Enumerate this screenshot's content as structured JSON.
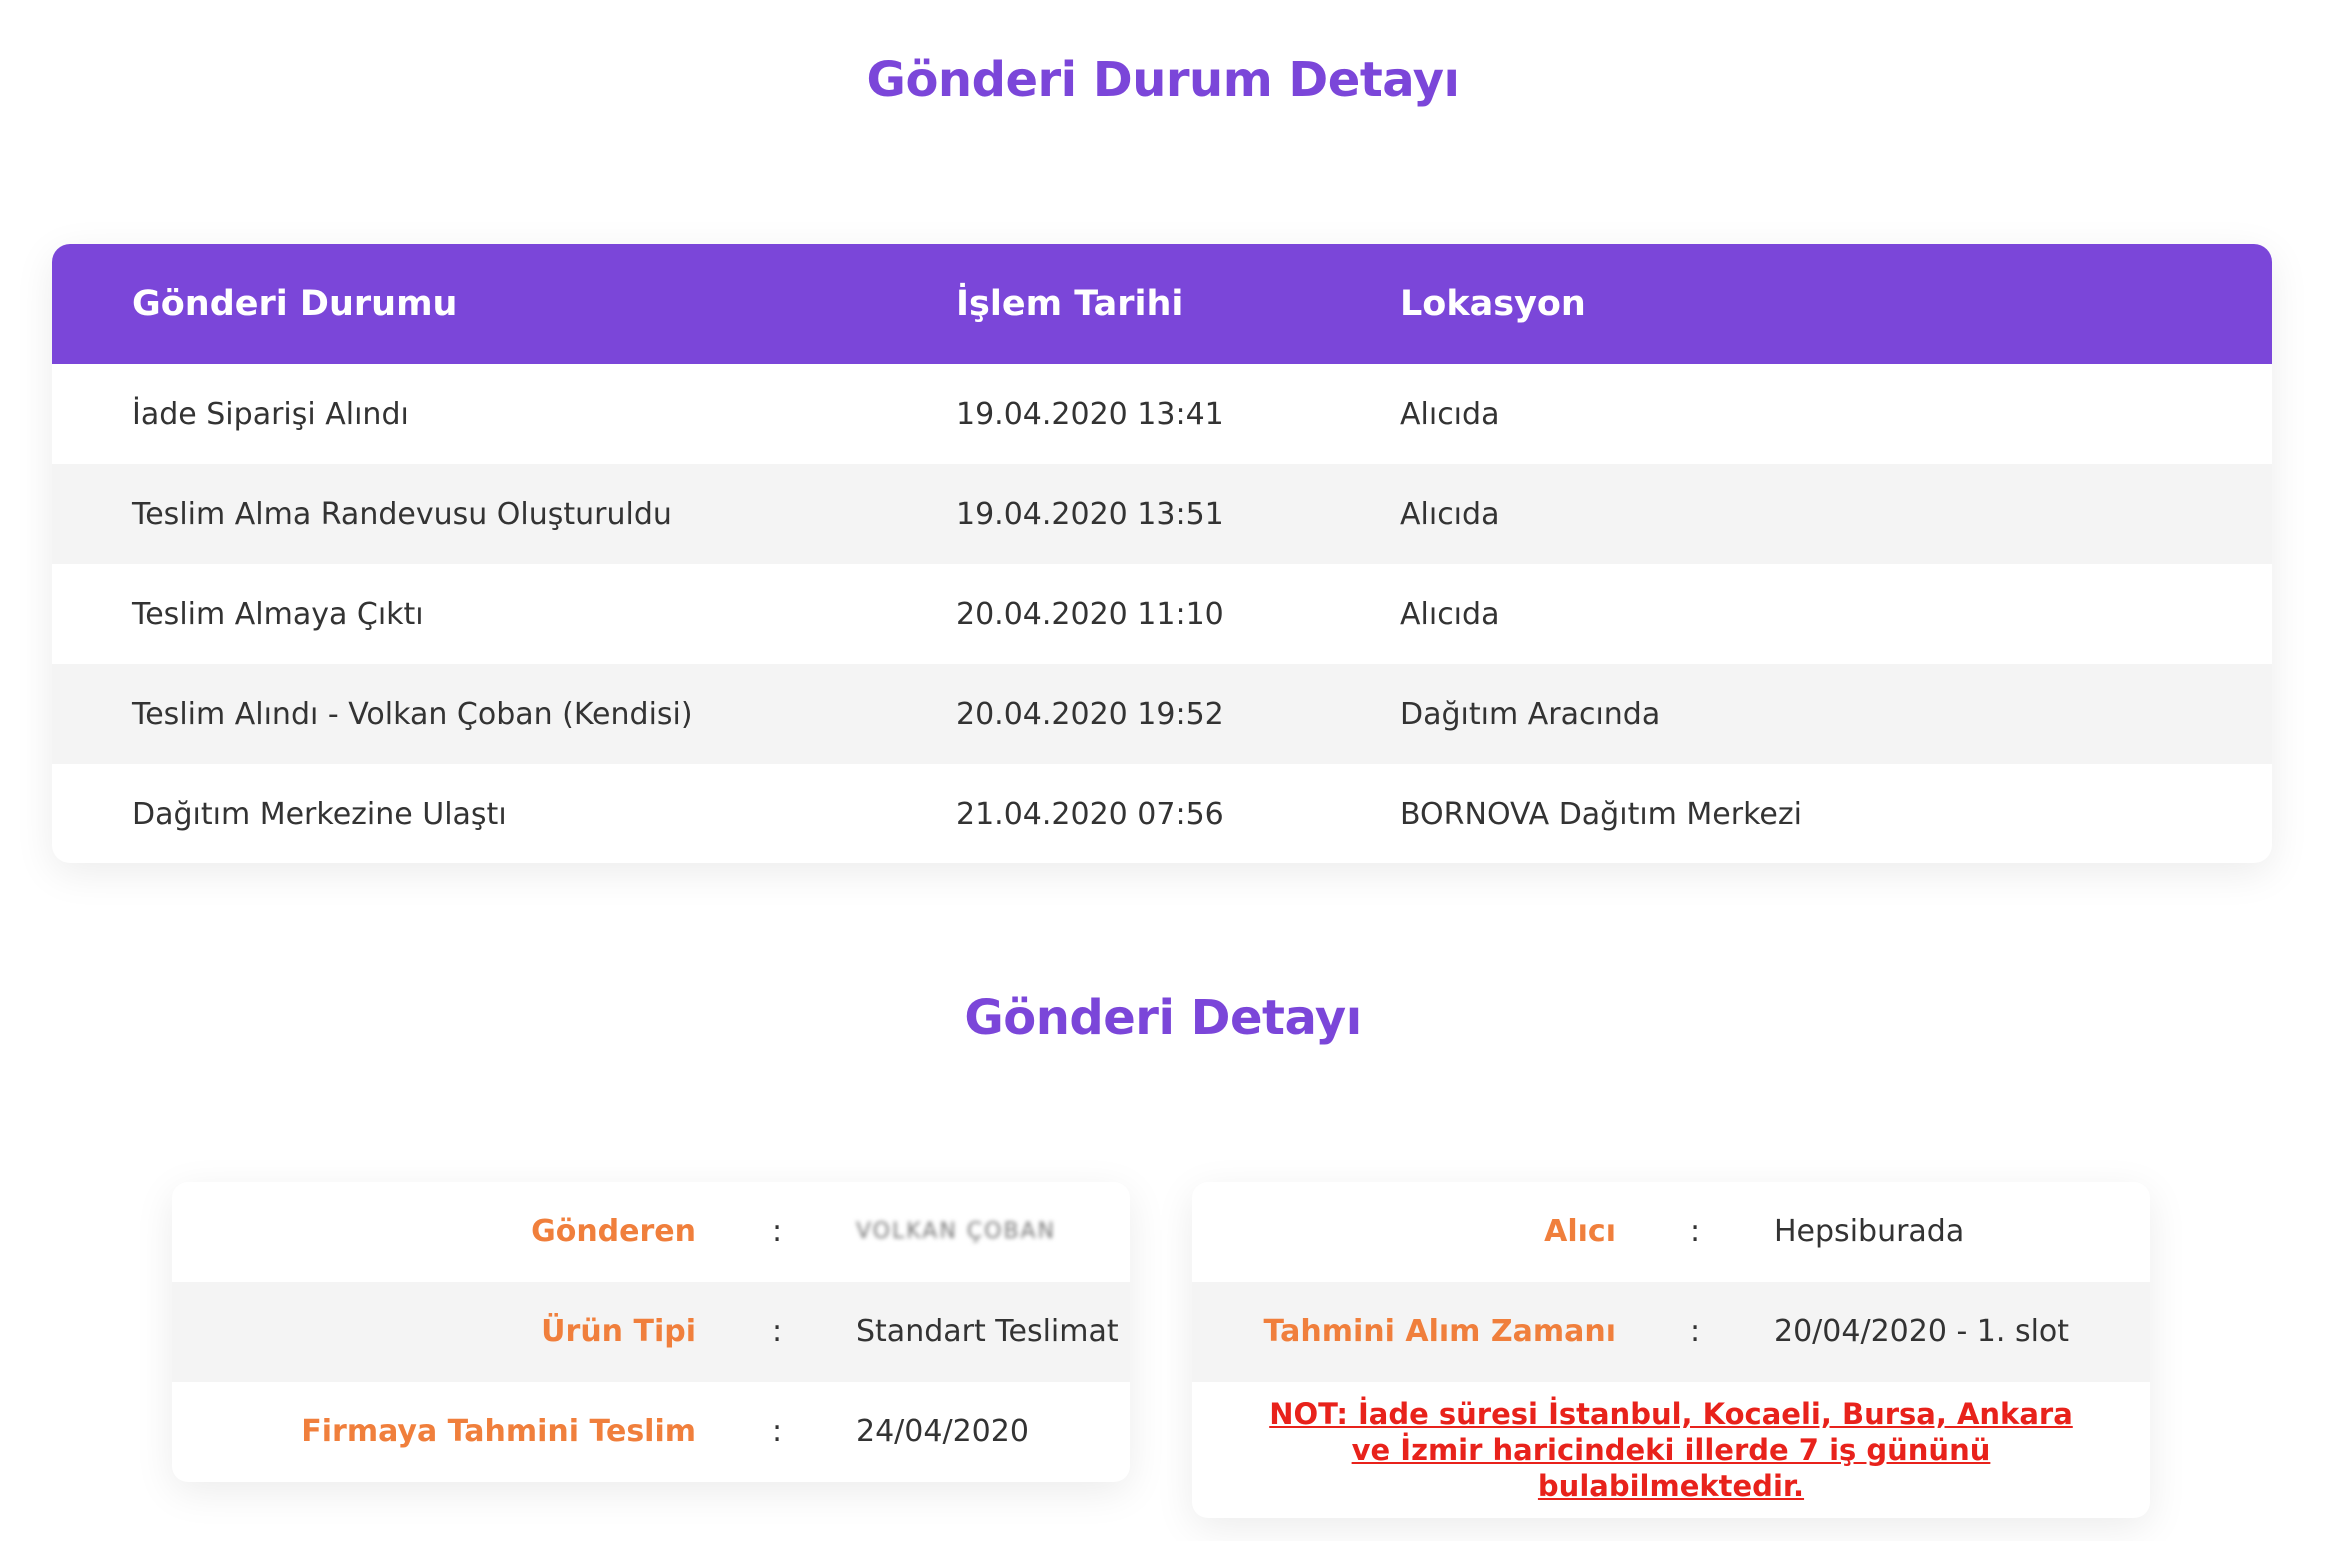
{
  "status_section": {
    "title": "Gönderi Durum Detayı",
    "columns": [
      "Gönderi Durumu",
      "İşlem Tarihi",
      "Lokasyon"
    ],
    "rows": [
      {
        "status": "İade Siparişi Alındı",
        "date": "19.04.2020 13:41",
        "location": "Alıcıda"
      },
      {
        "status": "Teslim Alma Randevusu Oluşturuldu",
        "date": "19.04.2020 13:51",
        "location": "Alıcıda"
      },
      {
        "status": "Teslim Almaya Çıktı",
        "date": "20.04.2020 11:10",
        "location": "Alıcıda"
      },
      {
        "status": "Teslim Alındı - Volkan Çoban (Kendisi)",
        "date": "20.04.2020 19:52",
        "location": "Dağıtım Aracında"
      },
      {
        "status": "Dağıtım Merkezine Ulaştı",
        "date": "21.04.2020 07:56",
        "location": "BORNOVA Dağıtım Merkezi"
      }
    ]
  },
  "detail_section": {
    "title": "Gönderi Detayı",
    "left": [
      {
        "label": "Gönderen",
        "colon": ":",
        "value": "VOLKAN ÇOBAN"
      },
      {
        "label": "Ürün Tipi",
        "colon": ":",
        "value": "Standart Teslimat"
      },
      {
        "label": "Firmaya Tahmini Teslim Zamanı",
        "colon": ":",
        "value": "24/04/2020"
      }
    ],
    "right": [
      {
        "label": "Alıcı",
        "colon": ":",
        "value": "Hepsiburada"
      },
      {
        "label": "Tahmini Alım Zamanı",
        "colon": ":",
        "value": "20/04/2020 - 1. slot"
      }
    ],
    "note": "NOT: İade süresi İstanbul, Kocaeli, Bursa, Ankara ve İzmir haricindeki illerde 7 iş gününü bulabilmektedir."
  },
  "colors": {
    "accent": "#7b46d9",
    "label": "#f07f3c",
    "note": "#e8221b",
    "row_alt": "#f4f4f4"
  }
}
